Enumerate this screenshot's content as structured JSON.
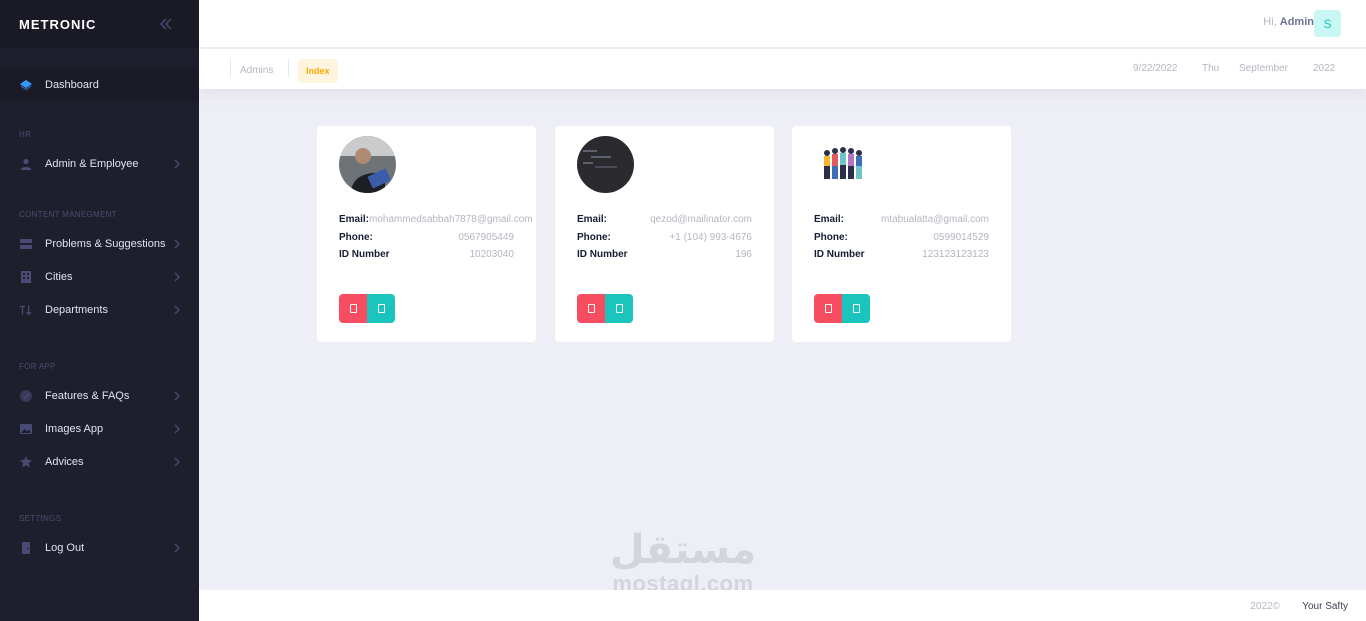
{
  "sidebar": {
    "brand": "METRONIC",
    "dashboard": "Dashboard",
    "sections": {
      "hr": "HR",
      "content": "CONTENT MANEGMENT",
      "app": "FOR APP",
      "settings": "SETTINGS"
    },
    "items": {
      "admin_employee": "Admin & Employee",
      "problems": "Problems & Suggestions",
      "cities": "Cities",
      "departments": "Departments",
      "features": "Features & FAQs",
      "images": "Images App",
      "advices": "Advices",
      "logout": "Log Out"
    },
    "icons": {
      "collapse": "double-chevron-left-icon",
      "dashboard": "layers-icon",
      "admin": "user-icon",
      "problems": "server-icon",
      "cities": "building-icon",
      "departments": "sort-arrows-icon",
      "features": "check-circle-icon",
      "images": "image-icon",
      "advices": "star-icon",
      "logout": "door-icon"
    }
  },
  "header": {
    "greeting": "Hi,",
    "username": "Admin",
    "avatar_letter": "S"
  },
  "subheader": {
    "breadcrumb": [
      "Admins",
      "Index"
    ],
    "date": "9/22/2022",
    "day": "Thu",
    "month": "September",
    "year": "2022"
  },
  "labels": {
    "email": "Email:",
    "phone": "Phone:",
    "id": "ID Number"
  },
  "cards": [
    {
      "email": "mohammedsabbah7878@gmail.com",
      "phone": "0567905449",
      "id_number": "10203040"
    },
    {
      "email": "qezod@mailinator.com",
      "phone": "+1 (104) 993-4676",
      "id_number": "196"
    },
    {
      "email": "mtabualatta@gmail.com",
      "phone": "0599014529",
      "id_number": "123123123123"
    }
  ],
  "footer": {
    "year": "2022©",
    "brand": "Your Safty"
  },
  "watermark": {
    "arabic": "مستقل",
    "latin": "mostaql.com"
  },
  "colors": {
    "sidebar_bg": "#1e1e2d",
    "accent_blue": "#3699ff",
    "danger": "#f64e60",
    "success": "#1bc5bd",
    "warning": "#ffa800",
    "page_bg": "#eeeef6"
  }
}
